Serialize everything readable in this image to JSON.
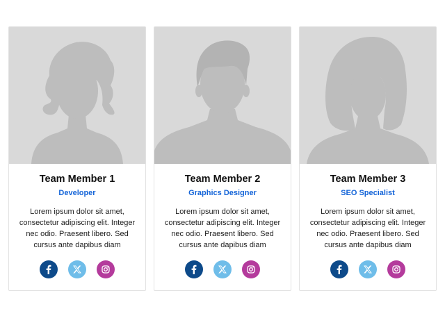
{
  "colors": {
    "accent": "#1565d8",
    "photo_bg": "#d9d9d9",
    "silhouette": "#bdbdbd",
    "facebook": "#0d4a8a",
    "twitter": "#6fbde9",
    "instagram": "#b43b9c"
  },
  "team": [
    {
      "name": "Team Member 1",
      "role": "Developer",
      "description": "Lorem ipsum dolor sit amet, consectetur adipiscing elit. Integer nec odio. Praesent libero. Sed cursus ante dapibus diam",
      "avatar": "female-curly-silhouette",
      "socials": [
        "facebook-icon",
        "x-twitter-icon",
        "instagram-icon"
      ]
    },
    {
      "name": "Team Member 2",
      "role": "Graphics Designer",
      "description": "Lorem ipsum dolor sit amet, consectetur adipiscing elit. Integer nec odio. Praesent libero. Sed cursus ante dapibus diam",
      "avatar": "male-silhouette",
      "socials": [
        "facebook-icon",
        "x-twitter-icon",
        "instagram-icon"
      ]
    },
    {
      "name": "Team Member 3",
      "role": "SEO Specialist",
      "description": "Lorem ipsum dolor sit amet, consectetur adipiscing elit. Integer nec odio. Praesent libero. Sed cursus ante dapibus diam",
      "avatar": "female-bob-silhouette",
      "socials": [
        "facebook-icon",
        "x-twitter-icon",
        "instagram-icon"
      ]
    }
  ]
}
